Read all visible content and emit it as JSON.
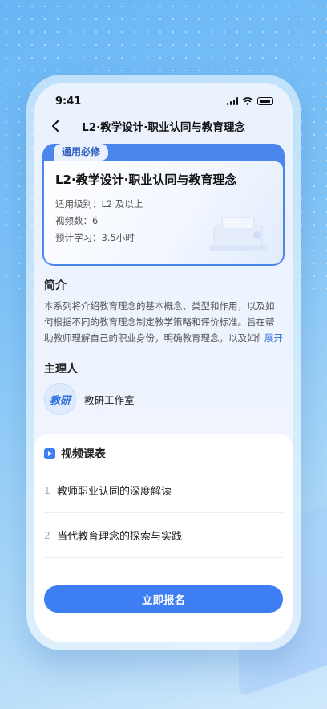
{
  "status_bar": {
    "time": "9:41"
  },
  "nav": {
    "title": "L2·教学设计·职业认同与教育理念"
  },
  "course_card": {
    "tag": "通用必修",
    "title": "L2·教学设计·职业认同与教育理念",
    "meta": [
      "适用级别：L2 及以上",
      "视频数：6",
      "预计学习：3.5小时"
    ]
  },
  "intro": {
    "title": "简介",
    "text": "本系列将介绍教育理念的基本概念、类型和作用，以及如何根据不同的教育理念制定教学策略和评价标准。旨在帮助教师理解自己的职业身份，明确教育理念，以及如何...",
    "expand_label": "展开"
  },
  "host": {
    "title": "主理人",
    "avatar_text": "教研",
    "name": "教研工作室"
  },
  "schedule": {
    "title": "视频课表",
    "lessons": [
      {
        "num": "1",
        "title": "教师职业认同的深度解读"
      },
      {
        "num": "2",
        "title": "当代教育理念的探索与实践"
      }
    ]
  },
  "cta": {
    "label": "立即报名"
  },
  "colors": {
    "accent": "#3d7ef2",
    "card_border": "#4a86ec"
  },
  "icons": [
    "back-icon",
    "signal-icon",
    "wifi-icon",
    "battery-icon",
    "video-list-icon"
  ]
}
